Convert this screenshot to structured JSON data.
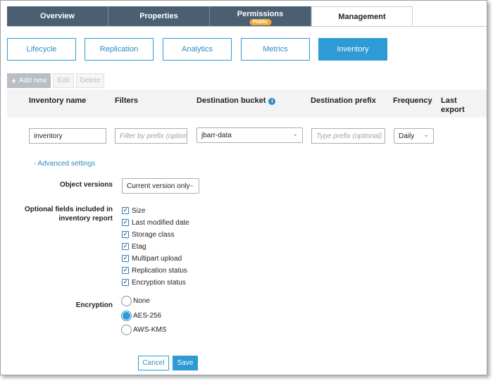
{
  "top_tabs": [
    {
      "label": "Overview"
    },
    {
      "label": "Properties"
    },
    {
      "label": "Permissions",
      "badge": "Public"
    },
    {
      "label": "Management",
      "active": true
    }
  ],
  "sub_tabs": [
    {
      "label": "Lifecycle"
    },
    {
      "label": "Replication"
    },
    {
      "label": "Analytics"
    },
    {
      "label": "Metrics"
    },
    {
      "label": "Inventory",
      "active": true
    }
  ],
  "actions": {
    "add_label": "Add new",
    "edit_label": "Edit",
    "delete_label": "Delete"
  },
  "table": {
    "headers": {
      "name": "Inventory name",
      "filters": "Filters",
      "bucket": "Destination bucket",
      "prefix": "Destination prefix",
      "frequency": "Frequency",
      "last_export_1": "Last",
      "last_export_2": "export"
    },
    "row": {
      "name_value": "inventory",
      "filter_placeholder": "Filter by prefix (option...",
      "bucket_value": "jbarr-data",
      "prefix_placeholder": "Type prefix (optional)",
      "frequency_value": "Daily"
    }
  },
  "advanced_link": "- Advanced settings",
  "object_versions": {
    "label": "Object versions",
    "value": "Current version only"
  },
  "optional_fields": {
    "label_1": "Optional fields included in",
    "label_2": "inventory report",
    "items": [
      {
        "label": "Size",
        "checked": true
      },
      {
        "label": "Last modified date",
        "checked": true
      },
      {
        "label": "Storage class",
        "checked": true
      },
      {
        "label": "Etag",
        "checked": true
      },
      {
        "label": "Multipart upload",
        "checked": true
      },
      {
        "label": "Replication status",
        "checked": true
      },
      {
        "label": "Encryption status",
        "checked": true
      }
    ]
  },
  "encryption": {
    "label": "Encryption",
    "options": [
      {
        "label": "None",
        "selected": false
      },
      {
        "label": "AES-256",
        "selected": true
      },
      {
        "label": "AWS-KMS",
        "selected": false
      }
    ]
  },
  "buttons": {
    "cancel": "Cancel",
    "save": "Save"
  },
  "colors": {
    "accent": "#2e9ad6",
    "tab_dark": "#4b5f73",
    "badge": "#f3a93a"
  }
}
